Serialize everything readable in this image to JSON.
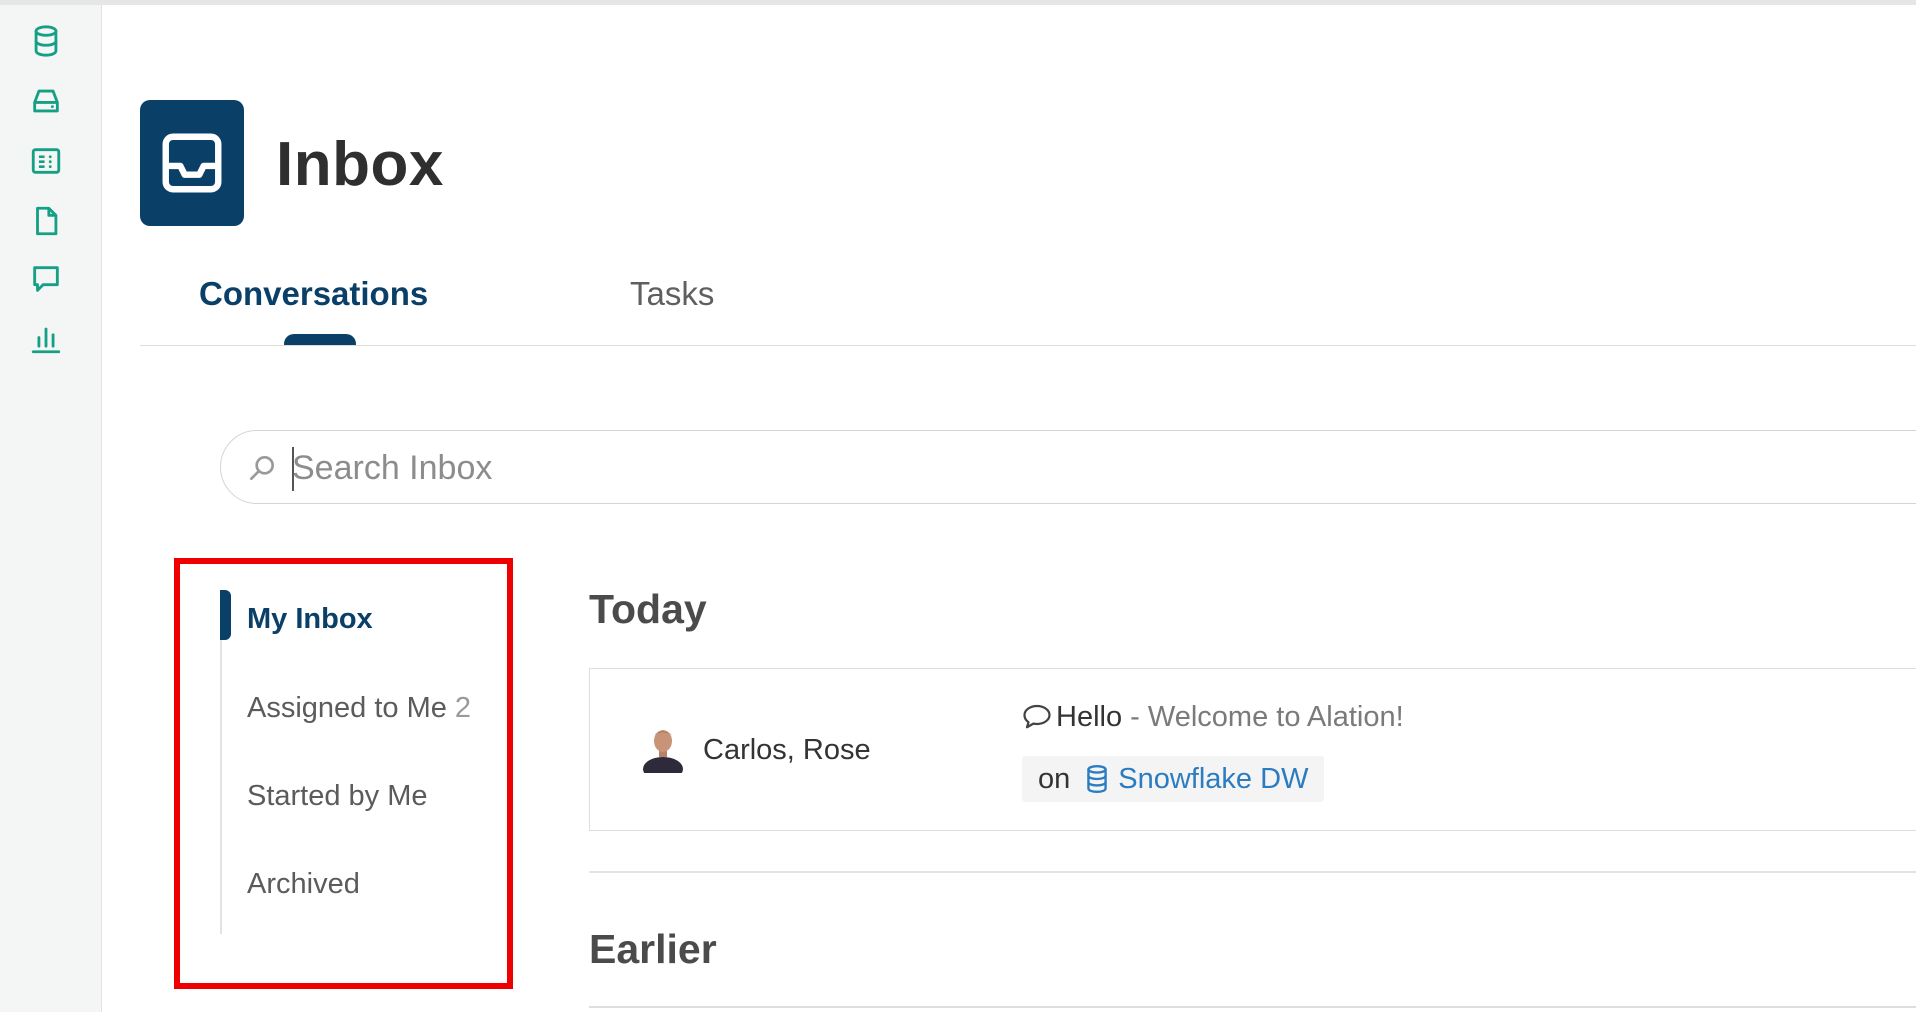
{
  "rail": {
    "icons": [
      "database-icon",
      "storage-icon",
      "catalog-icon",
      "document-icon",
      "conversation-icon",
      "analytics-icon"
    ],
    "accent": "#15a085"
  },
  "header": {
    "title": "Inbox",
    "tile_color": "#0a3f68",
    "tile_icon": "inbox-icon"
  },
  "tabs": [
    {
      "label": "Conversations",
      "active": true
    },
    {
      "label": "Tasks",
      "active": false
    }
  ],
  "search": {
    "placeholder": "Search Inbox",
    "icon": "search-icon"
  },
  "nav": {
    "items": [
      {
        "label": "My Inbox",
        "count": "",
        "active": true
      },
      {
        "label": "Assigned to Me",
        "count": "2",
        "active": false
      },
      {
        "label": "Started by Me",
        "count": "",
        "active": false
      },
      {
        "label": "Archived",
        "count": "",
        "active": false
      }
    ]
  },
  "sections": {
    "today": "Today",
    "earlier": "Earlier"
  },
  "conversations": [
    {
      "participants": "Carlos, Rose",
      "subject": "Hello",
      "separator": " - ",
      "preview": "Welcome to Alation!",
      "on_label": "on",
      "object_name": "Snowflake DW",
      "object_icon": "database-icon"
    }
  ],
  "colors": {
    "brand_navy": "#0a3f68",
    "link_blue": "#2b7cc1",
    "highlight_red": "#ee0000"
  }
}
